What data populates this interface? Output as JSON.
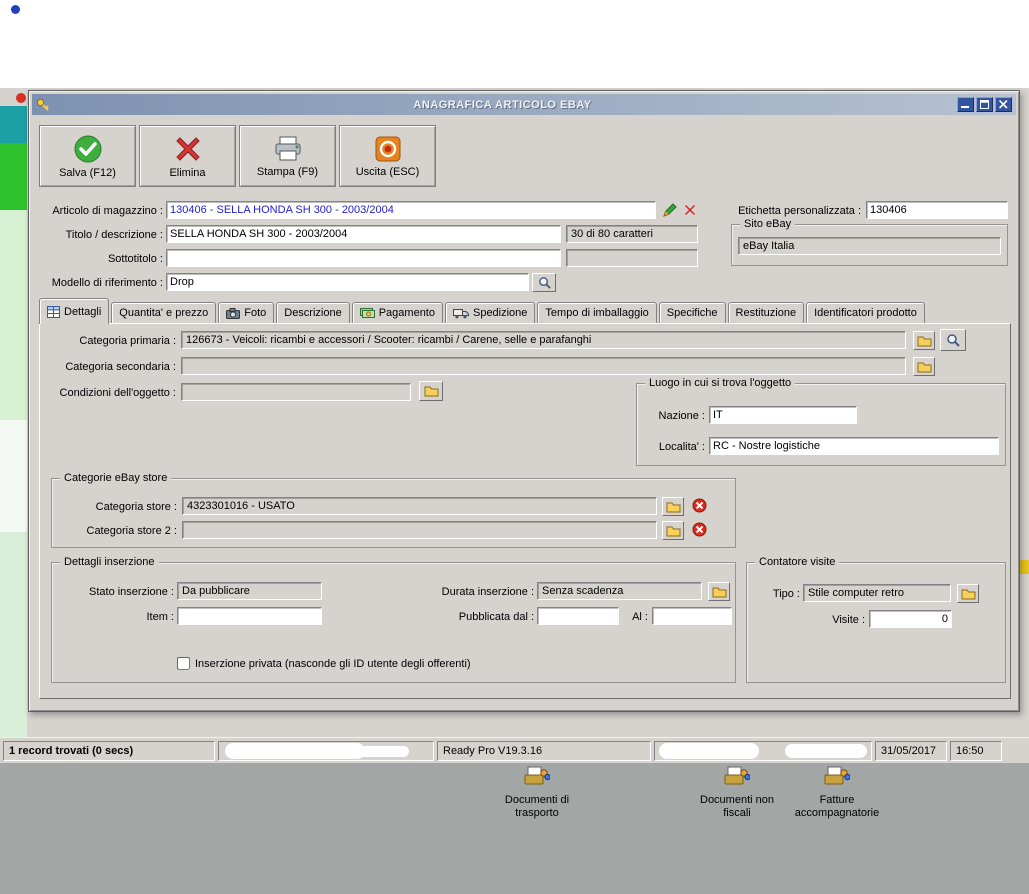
{
  "colors": {
    "accent_article_text": "#2323cc",
    "titlebar_gradient_from": "#7d92b0",
    "titlebar_gradient_to": "#b6c2d2",
    "chrome_gray": "#d6d3ce",
    "desktop_gray": "#a2a6a5",
    "save_green": "#3fae3f",
    "delete_red": "#d43535",
    "exit_orange": "#e8821e"
  },
  "window": {
    "title": "ANAGRAFICA ARTICOLO EBAY"
  },
  "toolbar": {
    "save_label": "Salva (F12)",
    "delete_label": "Elimina",
    "print_label": "Stampa (F9)",
    "exit_label": "Uscita (ESC)"
  },
  "form": {
    "articolo_label": "Articolo di magazzino :",
    "articolo_value": "130406 - SELLA HONDA SH 300 - 2003/2004",
    "etichetta_label": "Etichetta personalizzata :",
    "etichetta_value": "130406",
    "titolo_label": "Titolo / descrizione :",
    "titolo_value": "SELLA HONDA SH 300 - 2003/2004",
    "titolo_counter": "30 di 80 caratteri",
    "sottotitolo_label": "Sottotitolo :",
    "sottotitolo_value": "",
    "sottotitolo_counter": "",
    "sito_group": "Sito eBay",
    "sito_value": "eBay Italia",
    "modello_label": "Modello di riferimento :",
    "modello_value": "Drop"
  },
  "tabs": [
    {
      "label": "Dettagli",
      "icon": "table-grid-icon",
      "selected": true
    },
    {
      "label": "Quantita' e prezzo"
    },
    {
      "label": "Foto",
      "icon": "camera-icon"
    },
    {
      "label": "Descrizione"
    },
    {
      "label": "Pagamento",
      "icon": "money-icon"
    },
    {
      "label": "Spedizione",
      "icon": "truck-icon"
    },
    {
      "label": "Tempo di imballaggio"
    },
    {
      "label": "Specifiche"
    },
    {
      "label": "Restituzione"
    },
    {
      "label": "Identificatori prodotto"
    }
  ],
  "dettagli": {
    "categoria_primaria_label": "Categoria primaria :",
    "categoria_primaria_value": "126673 - Veicoli: ricambi e accessori / Scooter: ricambi / Carene, selle e parafanghi",
    "categoria_secondaria_label": "Categoria secondaria :",
    "categoria_secondaria_value": "",
    "condizioni_label": "Condizioni dell'oggetto :",
    "condizioni_value": "",
    "luogo_group": "Luogo in cui si trova l'oggetto",
    "nazione_label": "Nazione :",
    "nazione_value": "IT",
    "localita_label": "Localita' :",
    "localita_value": "RC - Nostre logistiche",
    "store_group": "Categorie eBay store",
    "store_label": "Categoria store :",
    "store_value": "4323301016 - USATO",
    "store2_label": "Categoria store 2 :",
    "store2_value": "",
    "inserzione_group": "Dettagli inserzione",
    "stato_label": "Stato inserzione :",
    "stato_value": "Da pubblicare",
    "item_label": "Item :",
    "item_value": "",
    "durata_label": "Durata inserzione :",
    "durata_value": "Senza scadenza",
    "pubblicata_label": "Pubblicata dal :",
    "pubblicata_value": "",
    "al_label": "Al :",
    "al_value": "",
    "privata_label": "Inserzione privata (nasconde gli ID utente degli offerenti)",
    "privata_checked": false,
    "contatore_group": "Contatore visite",
    "tipo_label": "Tipo :",
    "tipo_value": "Stile computer retro",
    "visite_label": "Visite :",
    "visite_value": "0"
  },
  "statusbar": {
    "records": "1 record trovati (0 secs)",
    "version": "Ready Pro V19.3.16",
    "date": "31/05/2017",
    "time": "16:50"
  },
  "desktop": {
    "icons": [
      {
        "label": "Documenti di trasporto",
        "icon": "documents-icon"
      },
      {
        "label": "Documenti non fiscali",
        "icon": "documents-icon"
      },
      {
        "label": "Fatture accompagnatorie",
        "icon": "documents-icon"
      }
    ]
  }
}
